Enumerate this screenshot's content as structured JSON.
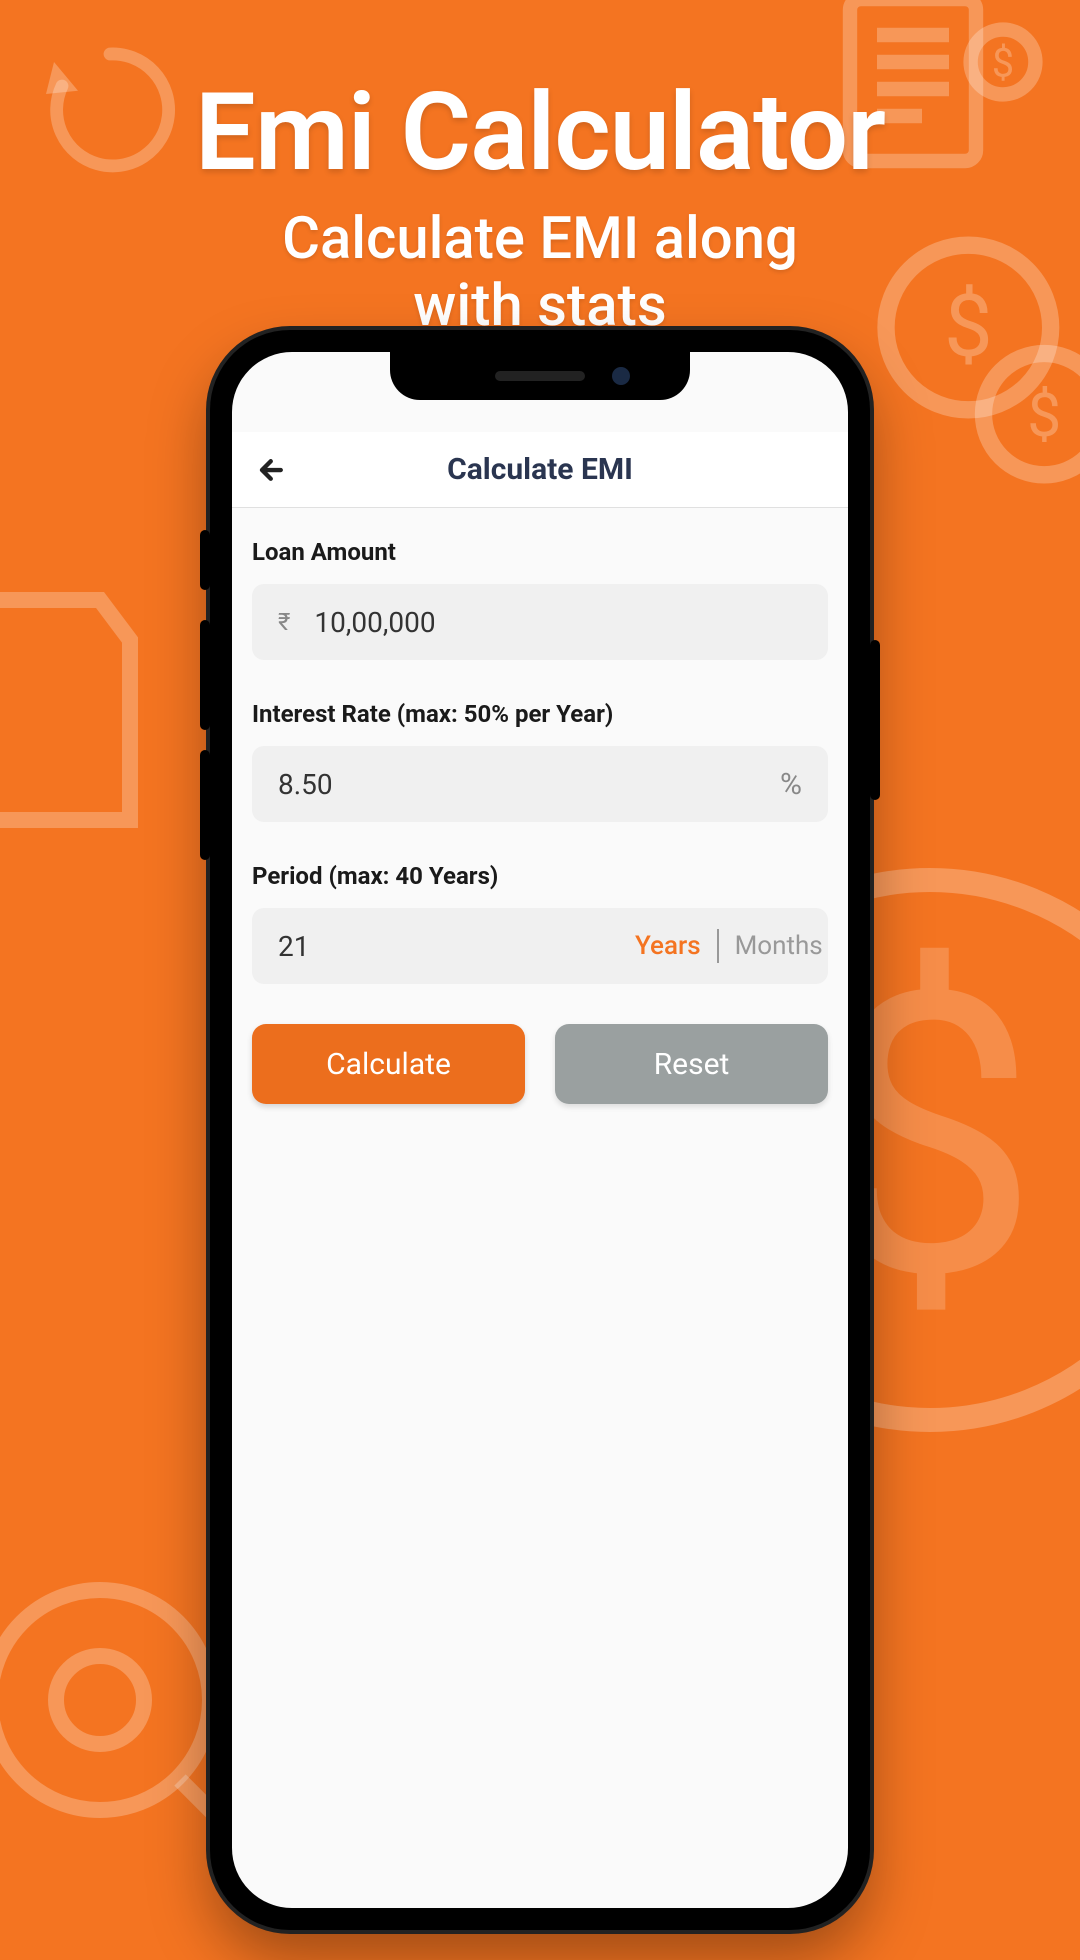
{
  "promo": {
    "title": "Emi Calculator",
    "subtitle": "Calculate EMI along\nwith stats"
  },
  "app": {
    "header_title": "Calculate EMI",
    "fields": {
      "loan_amount": {
        "label": "Loan Amount",
        "prefix": "₹",
        "value": "10,00,000"
      },
      "interest_rate": {
        "label": "Interest Rate (max: 50% per Year)",
        "value": "8.50",
        "suffix": "%"
      },
      "period": {
        "label": "Period (max: 40 Years)",
        "value": "21",
        "unit_active": "Years",
        "unit_inactive": "Months"
      }
    },
    "buttons": {
      "calculate": "Calculate",
      "reset": "Reset"
    }
  }
}
